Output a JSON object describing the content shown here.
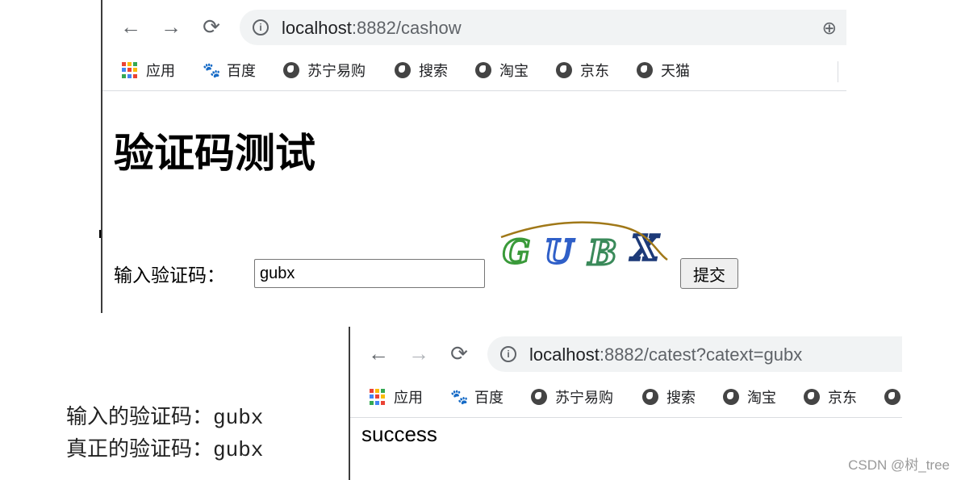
{
  "window1": {
    "url_host": "localhost",
    "url_path": ":8882/cashow",
    "bookmarks": [
      {
        "label": "应用",
        "icon": "apps-icon"
      },
      {
        "label": "百度",
        "icon": "baidu-icon"
      },
      {
        "label": "苏宁易购",
        "icon": "globe-icon"
      },
      {
        "label": "搜索",
        "icon": "globe-icon"
      },
      {
        "label": "淘宝",
        "icon": "globe-icon"
      },
      {
        "label": "京东",
        "icon": "globe-icon"
      },
      {
        "label": "天猫",
        "icon": "globe-icon"
      }
    ],
    "page": {
      "title": "验证码测试",
      "input_label": "输入验证码：",
      "input_value": "gubx",
      "captcha_text": [
        "G",
        "U",
        "B",
        "X"
      ],
      "submit_label": "提交"
    }
  },
  "window2": {
    "url_host": "localhost",
    "url_path": ":8882/catest?catext=gubx",
    "bookmarks": [
      {
        "label": "应用",
        "icon": "apps-icon"
      },
      {
        "label": "百度",
        "icon": "baidu-icon"
      },
      {
        "label": "苏宁易购",
        "icon": "globe-icon"
      },
      {
        "label": "搜索",
        "icon": "globe-icon"
      },
      {
        "label": "淘宝",
        "icon": "globe-icon"
      },
      {
        "label": "京东",
        "icon": "globe-icon"
      }
    ],
    "result": "success"
  },
  "console": {
    "line1": "输入的验证码：gubx",
    "line2": "真正的验证码：gubx"
  },
  "watermark": "CSDN @树_tree",
  "colors": {
    "captcha_g": "#3a9a3a",
    "captcha_u": "#2f5fc8",
    "captcha_b": "#3a8a5a",
    "captcha_x": "#1d3a78",
    "captcha_line": "#a07818"
  }
}
